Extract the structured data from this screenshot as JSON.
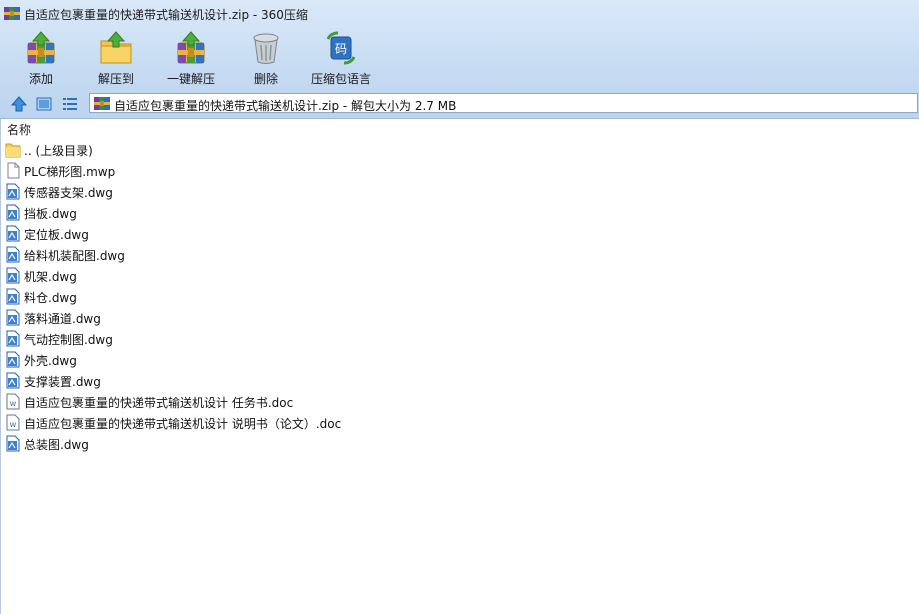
{
  "window": {
    "title": "自适应包裹重量的快递带式输送机设计.zip - 360压缩"
  },
  "toolbar": {
    "buttons": [
      {
        "label": "添加",
        "icon": "add-archive-icon"
      },
      {
        "label": "解压到",
        "icon": "extract-to-icon"
      },
      {
        "label": "一键解压",
        "icon": "one-click-extract-icon"
      },
      {
        "label": "删除",
        "icon": "trash-can-icon"
      },
      {
        "label": "压缩包语言",
        "icon": "archive-language-icon"
      }
    ]
  },
  "address": {
    "text": "自适应包裹重量的快递带式输送机设计.zip - 解包大小为 2.7 MB"
  },
  "list": {
    "column_name": "名称",
    "items": [
      {
        "name": ".. (上级目录)",
        "type": "folder"
      },
      {
        "name": "PLC梯形图.mwp",
        "type": "blank"
      },
      {
        "name": "传感器支架.dwg",
        "type": "dwg"
      },
      {
        "name": "挡板.dwg",
        "type": "dwg"
      },
      {
        "name": "定位板.dwg",
        "type": "dwg"
      },
      {
        "name": "给料机装配图.dwg",
        "type": "dwg"
      },
      {
        "name": "机架.dwg",
        "type": "dwg"
      },
      {
        "name": "料仓.dwg",
        "type": "dwg"
      },
      {
        "name": "落料通道.dwg",
        "type": "dwg"
      },
      {
        "name": "气动控制图.dwg",
        "type": "dwg"
      },
      {
        "name": "外壳.dwg",
        "type": "dwg"
      },
      {
        "name": "支撑装置.dwg",
        "type": "dwg"
      },
      {
        "name": "自适应包裹重量的快递带式输送机设计 任务书.doc",
        "type": "doc"
      },
      {
        "name": "自适应包裹重量的快递带式输送机设计 说明书（论文）.doc",
        "type": "doc"
      },
      {
        "name": "总装图.dwg",
        "type": "dwg"
      }
    ]
  }
}
